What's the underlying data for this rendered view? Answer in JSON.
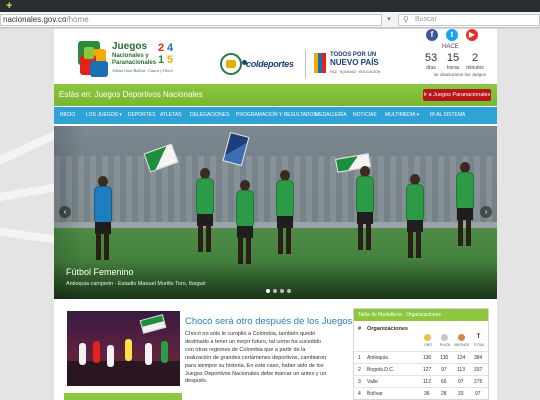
{
  "browser": {
    "url_host": "nacionales.gov.co",
    "url_path": "/home",
    "search_placeholder": "Buscar"
  },
  "header": {
    "logo": {
      "title_lines": [
        "Juegos",
        "Nacionales y",
        "Paranacionales"
      ],
      "year_digits": [
        "2",
        "4",
        "1",
        "5"
      ],
      "tagline": "Tolima Gran Bolívar · Cauca y Chocó"
    },
    "coldeportes": "coldeportes",
    "todos_por": "TODOS POR UN",
    "nuevo_pais": "NUEVO PAÍS",
    "todos_tagline": "PAZ · EQUIDAD · EDUCACIÓN",
    "hace_label": "HACE",
    "countdown": [
      {
        "value": "53",
        "unit": "días"
      },
      {
        "value": "15",
        "unit": "horas"
      },
      {
        "value": "2",
        "unit": "minutos"
      }
    ],
    "countdown_note": "se clausuraron los Juegos"
  },
  "banner": {
    "text": "Estás en: Juegos Deportivos Nacionales",
    "para_button": "Ir a Juegos Paranacionales"
  },
  "nav": [
    {
      "label": "INICIO"
    },
    {
      "label": "LOS JUEGOS ▾"
    },
    {
      "label": "DEPORTES"
    },
    {
      "label": "ATLETAS"
    },
    {
      "label": "DELEGACIONES"
    },
    {
      "label": "PROGRAMACIÓN Y RESULTADOS"
    },
    {
      "label": "MEDALLERÍA"
    },
    {
      "label": "NOTICIAS"
    },
    {
      "label": "MULTIMEDIA ▾"
    },
    {
      "label": "IR AL SISTEMA"
    }
  ],
  "hero": {
    "title": "Fútbol Femenino",
    "subtitle": "Antioquia campeón · Estadio Manuel Murillo Toro, Ibagué"
  },
  "news": {
    "title": "Chocó será otro después de los Juegos",
    "body": "Chocó no sólo le cumplió a Colombia, también quedó destinado a tener un mejor futuro, tal como ha sucedido con otras regiones de Colombia que a partir de la realización de grandes certámenes deportivos, cambiaron para siempre su historia. En este caso, haber sido de los Juegos Deportivos Nacionales debe marcar un antes y un después."
  },
  "medal_table": {
    "title": "Tabla de Medallería · Organizaciones",
    "col_hash": "#",
    "col_org": "Organizaciones",
    "medal_labels": [
      "ORO",
      "PLATA",
      "BRONCE",
      "TOTAL"
    ],
    "total_letter": "T",
    "colors": {
      "gold": "#e8c04a",
      "silver": "#c8c8c8",
      "bronze": "#c98b4c",
      "total": "#ffffff"
    },
    "rows": [
      {
        "rank": "1",
        "org": "Antioquia",
        "gold": "130",
        "silver": "130",
        "bronze": "124",
        "total": "384"
      },
      {
        "rank": "2",
        "org": "Bogotá D.C.",
        "gold": "127",
        "silver": "97",
        "bronze": "113",
        "total": "337"
      },
      {
        "rank": "3",
        "org": "Valle",
        "gold": "112",
        "silver": "66",
        "bronze": "97",
        "total": "275"
      },
      {
        "rank": "4",
        "org": "Bolívar",
        "gold": "36",
        "silver": "28",
        "bronze": "33",
        "total": "97"
      }
    ]
  },
  "colors": {
    "green": "#8dc63f",
    "nav_blue": "#2fa3d6",
    "red_button": "#b8141a",
    "news_title": "#2a7fc0"
  }
}
